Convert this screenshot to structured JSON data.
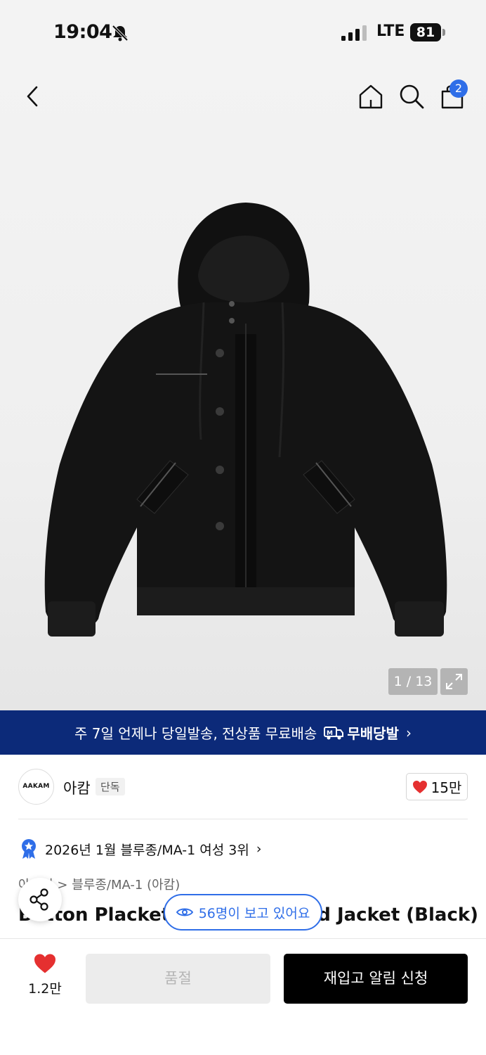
{
  "status_bar": {
    "time": "19:04",
    "network": "LTE",
    "battery": "81",
    "icons": [
      "bell-muted-icon",
      "signal-icon"
    ]
  },
  "nav": {
    "icons": [
      "back-icon",
      "home-icon",
      "search-icon",
      "bag-icon"
    ],
    "bag_badge": "2"
  },
  "gallery": {
    "pager": "1 / 13",
    "expand_icon": "expand-icon"
  },
  "banner": {
    "text": "주 7일 언제나 당일발송, 전상품 무료배송",
    "logo_text": "무배당발",
    "chevron": "›"
  },
  "brand": {
    "logo_text": "AAKAM",
    "name": "아캄",
    "tag": "단독",
    "likes": "15만"
  },
  "ranking": {
    "text": "2026년 1월 블루종/MA-1 여성 3위",
    "chevron": "›"
  },
  "product": {
    "breadcrumb": "아우터 > 블루종/MA-1 (아캄)",
    "title": "Button Placket Corduroy Hood Jacket (Black)"
  },
  "viewers": {
    "text": "56명이 보고 있어요"
  },
  "bottom_bar": {
    "wish_count": "1.2만",
    "soldout_label": "품절",
    "restock_label": "재입고 알림 신청"
  },
  "colors": {
    "accent_blue": "#2f6ee8",
    "banner_navy": "#0c2a79",
    "heart_red": "#e53030"
  }
}
